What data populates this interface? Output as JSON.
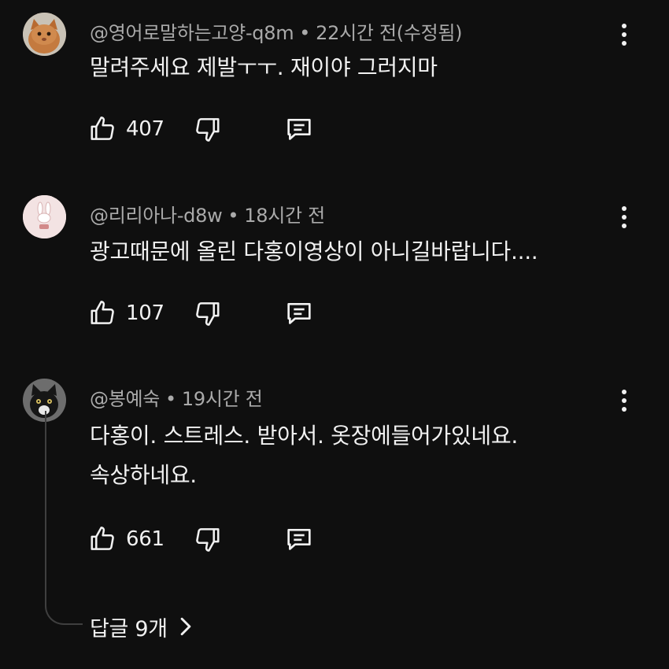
{
  "comments": [
    {
      "handle": "@영어로말하는고양-q8m",
      "separator": "•",
      "time": "22시간 전(수정됨)",
      "lines": [
        "말려주세요 제발ㅜㅜ. 재이야 그러지마"
      ],
      "likes": "407",
      "avatar_icon": "cat-photo-avatar"
    },
    {
      "handle": "@리리아나-d8w",
      "separator": "•",
      "time": "18시간 전",
      "lines": [
        "광고때문에 올린 다홍이영상이 아니길바랍니다...."
      ],
      "likes": "107",
      "avatar_icon": "bunny-avatar"
    },
    {
      "handle": "@봉예숙",
      "separator": "•",
      "time": "19시간 전",
      "lines": [
        "다홍이. 스트레스. 받아서.  옷장에들어가있네요.",
        "속상하네요."
      ],
      "likes": "661",
      "avatar_icon": "black-cat-avatar"
    }
  ],
  "replies": {
    "label": "답글 9개"
  },
  "colors": {
    "background": "#0f0f0f",
    "text_primary": "#f1f1f1",
    "text_secondary": "#aaaaaa",
    "thread_line": "#3f3f3f"
  }
}
